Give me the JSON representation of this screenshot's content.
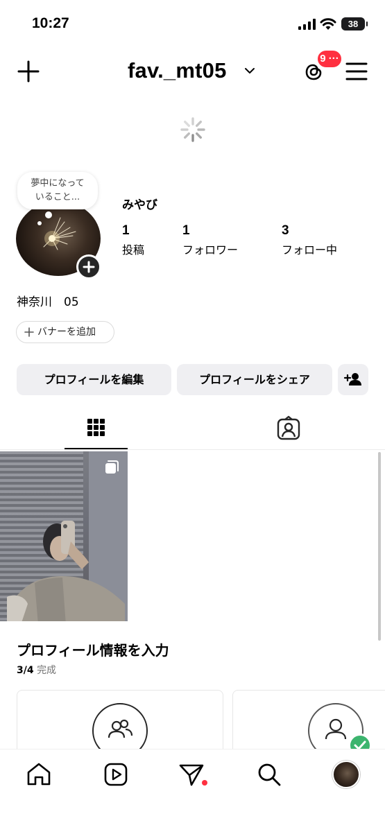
{
  "status_bar": {
    "time": "10:27",
    "battery": "38"
  },
  "header": {
    "username": "fav._mt05",
    "threads_badge": "9 ···"
  },
  "profile": {
    "note_line1": "夢中になって",
    "note_line2": "いること...",
    "display_name": "みやび",
    "stats": [
      {
        "count": "1",
        "label": "投稿"
      },
      {
        "count": "1",
        "label": "フォロワー"
      },
      {
        "count": "3",
        "label": "フォロー中"
      }
    ],
    "bio": "神奈川　05",
    "add_banner_label": "バナーを追加"
  },
  "actions": {
    "edit_profile": "プロフィールを編集",
    "share_profile": "プロフィールをシェア"
  },
  "profile_completion": {
    "title": "プロフィール情報を入力",
    "progress": "3/4",
    "progress_suffix": "完成"
  },
  "colors": {
    "badge": "#ff3040",
    "button_bg": "#efeff2",
    "check": "#3cb46e"
  },
  "icons": {
    "header": [
      "plus-icon",
      "chevron-down-icon",
      "threads-icon",
      "menu-icon"
    ],
    "tabs": [
      "grid-icon",
      "tagged-icon"
    ],
    "nav": [
      "home-icon",
      "reels-icon",
      "send-icon",
      "search-icon",
      "profile-avatar"
    ]
  }
}
